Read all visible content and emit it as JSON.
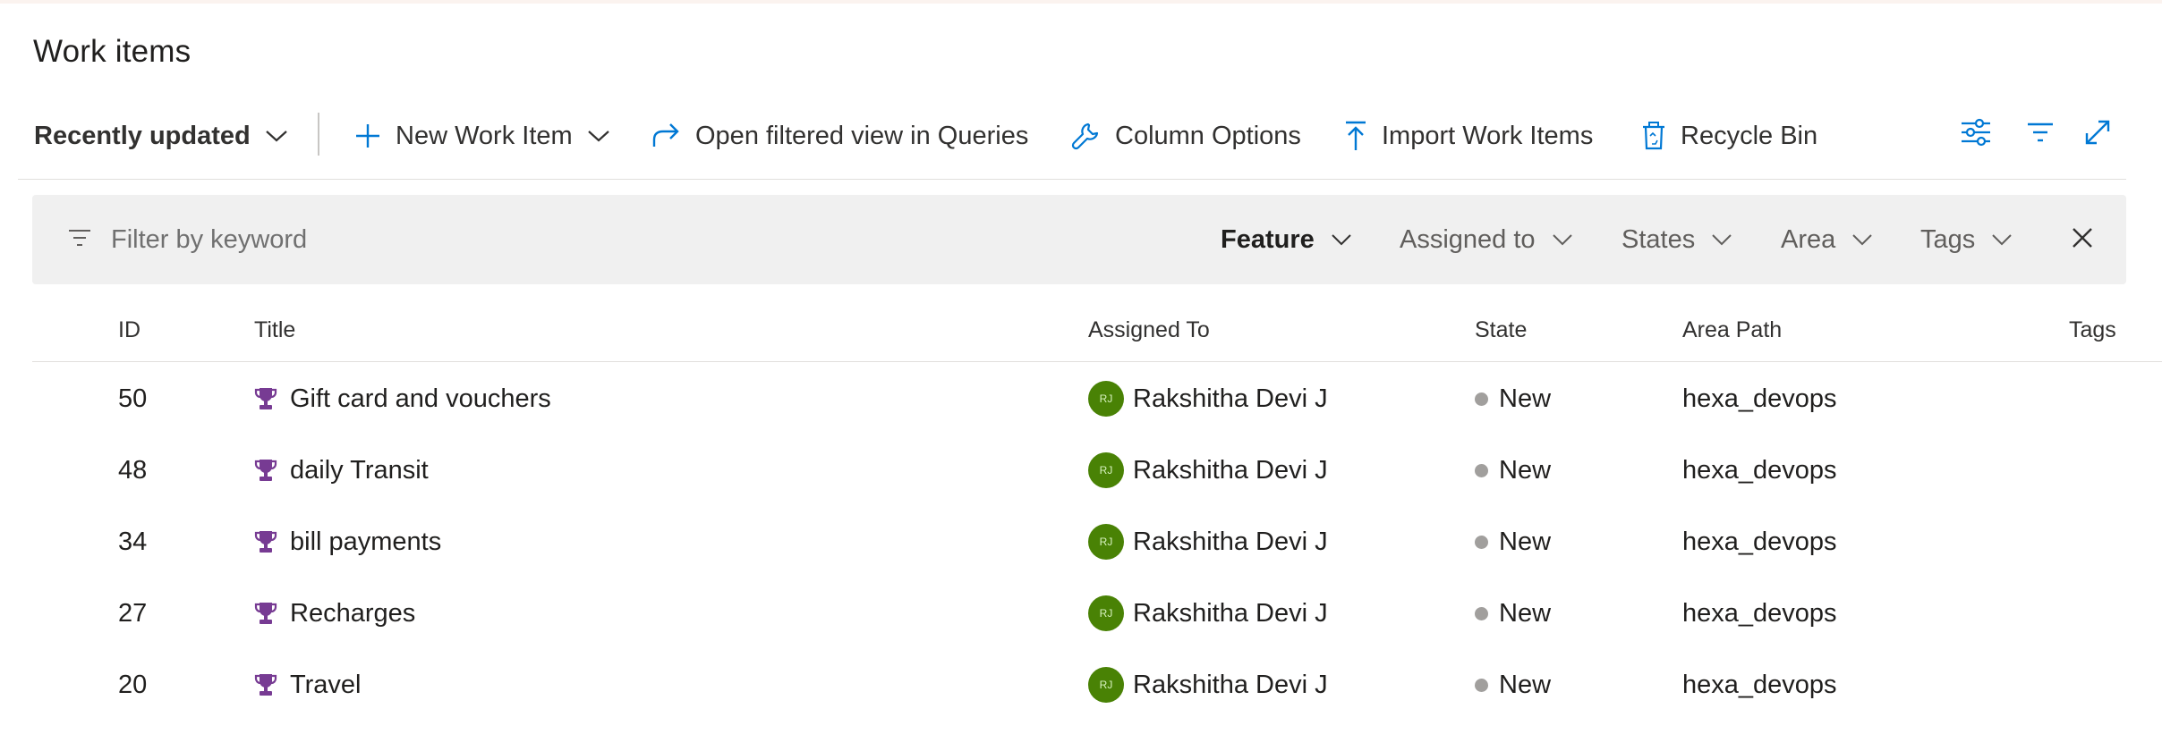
{
  "page": {
    "title": "Work items"
  },
  "toolbar": {
    "view_selector": "Recently updated",
    "new_item": "New Work Item",
    "open_queries": "Open filtered view in Queries",
    "column_options": "Column Options",
    "import": "Import Work Items",
    "recycle_bin": "Recycle Bin",
    "icons": [
      "plus-icon",
      "share-arrow-icon",
      "wrench-icon",
      "upload-icon",
      "trash-icon",
      "view-options-icon",
      "filter-icon",
      "fullscreen-icon"
    ]
  },
  "filter": {
    "placeholder": "Filter by keyword",
    "pills": [
      "Feature",
      "Assigned to",
      "States",
      "Area",
      "Tags"
    ],
    "active_pill": "Feature"
  },
  "table": {
    "columns": [
      "ID",
      "Title",
      "Assigned To",
      "State",
      "Area Path",
      "Tags"
    ],
    "rows": [
      {
        "id": "50",
        "title": "Gift card and vouchers",
        "assigned_initials": "RJ",
        "assigned": "Rakshitha Devi J",
        "state": "New",
        "area": "hexa_devops",
        "tags": ""
      },
      {
        "id": "48",
        "title": "daily Transit",
        "assigned_initials": "RJ",
        "assigned": "Rakshitha Devi J",
        "state": "New",
        "area": "hexa_devops",
        "tags": ""
      },
      {
        "id": "34",
        "title": "bill payments",
        "assigned_initials": "RJ",
        "assigned": "Rakshitha Devi J",
        "state": "New",
        "area": "hexa_devops",
        "tags": ""
      },
      {
        "id": "27",
        "title": "Recharges",
        "assigned_initials": "RJ",
        "assigned": "Rakshitha Devi J",
        "state": "New",
        "area": "hexa_devops",
        "tags": ""
      },
      {
        "id": "20",
        "title": "Travel",
        "assigned_initials": "RJ",
        "assigned": "Rakshitha Devi J",
        "state": "New",
        "area": "hexa_devops",
        "tags": ""
      }
    ]
  },
  "colors": {
    "accent_blue": "#0078d4",
    "avatar_green": "#498205",
    "feature_purple": "#773b93",
    "state_new_gray": "#a19f9d"
  }
}
